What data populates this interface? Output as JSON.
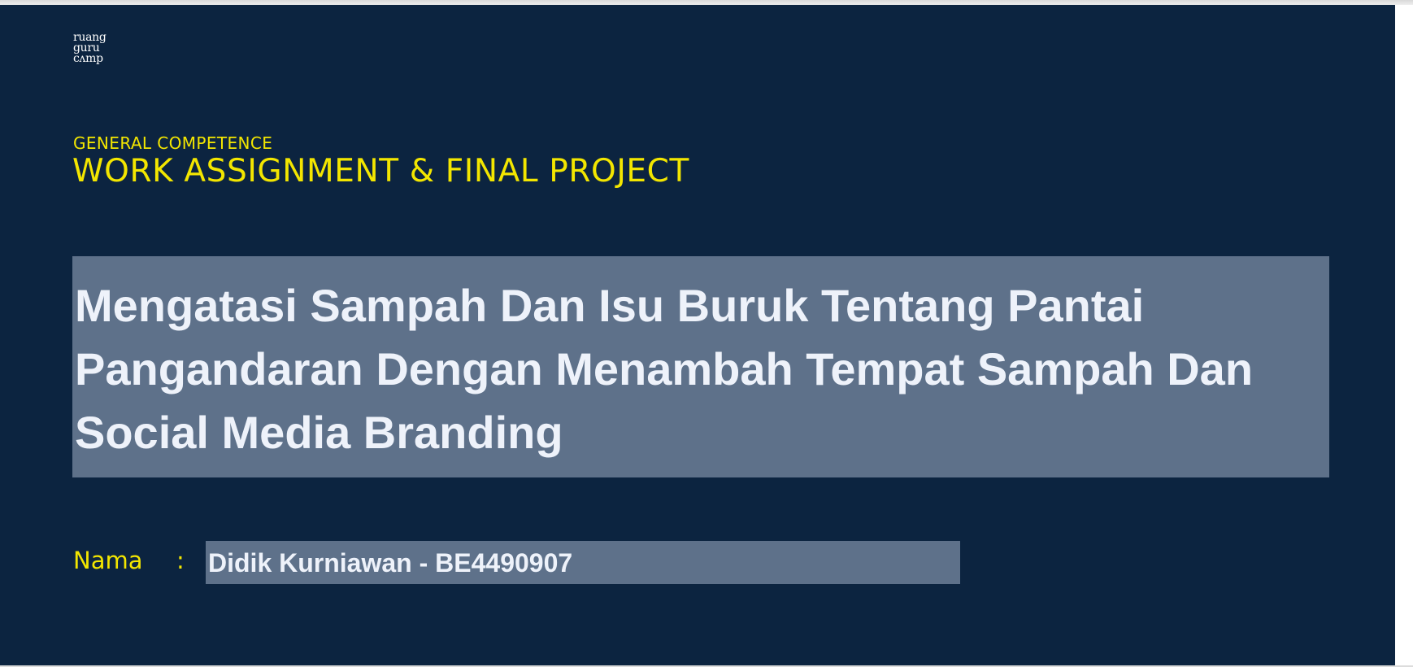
{
  "logo": {
    "line1": "ruang",
    "line2": "guru",
    "line3": "cʌmp"
  },
  "header": {
    "eyebrow": "GENERAL COMPETENCE",
    "title": "WORK ASSIGNMENT & FINAL PROJECT"
  },
  "project": {
    "title": "Mengatasi Sampah Dan Isu Buruk Tentang Pantai Pangandaran Dengan Menambah Tempat Sampah Dan Social Media Branding"
  },
  "student": {
    "label": "Nama",
    "separator": ":",
    "value": "Didik Kurniawan - BE4490907"
  },
  "colors": {
    "background": "#0c2440",
    "accent": "#f3e600",
    "field_fill": "#5e718a",
    "field_text": "#eef2fa"
  }
}
